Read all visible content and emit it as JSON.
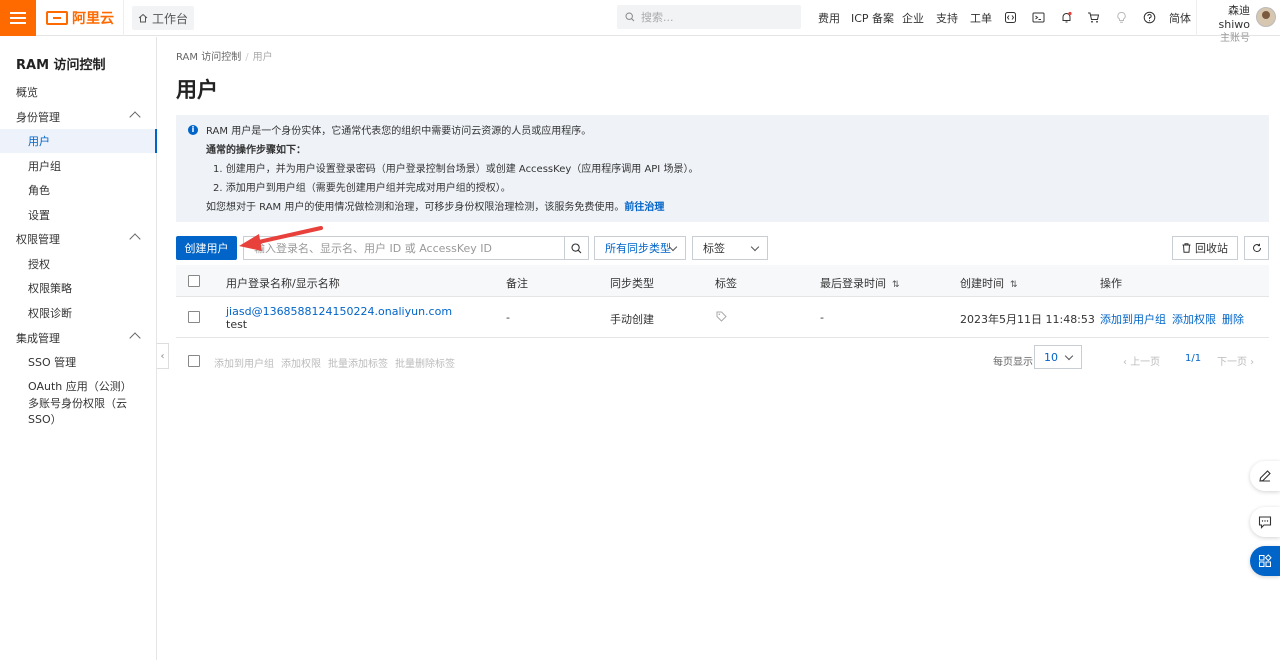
{
  "topbar": {
    "logo_text": "阿里云",
    "workbench": "工作台",
    "search_placeholder": "搜索...",
    "nav": [
      "费用",
      "ICP 备案",
      "企业",
      "支持",
      "工单"
    ],
    "lang": "简体",
    "user_name": "森迪shiwo",
    "user_role": "主账号"
  },
  "sidebar": {
    "title": "RAM 访问控制",
    "items": [
      {
        "label": "概览"
      },
      {
        "label": "身份管理"
      },
      {
        "label": "用户"
      },
      {
        "label": "用户组"
      },
      {
        "label": "角色"
      },
      {
        "label": "设置"
      },
      {
        "label": "权限管理"
      },
      {
        "label": "授权"
      },
      {
        "label": "权限策略"
      },
      {
        "label": "权限诊断"
      },
      {
        "label": "集成管理"
      },
      {
        "label": "SSO 管理"
      },
      {
        "label": "OAuth 应用（公测）"
      },
      {
        "label": "多账号身份权限（云 SSO）"
      }
    ]
  },
  "breadcrumb": {
    "root": "RAM 访问控制",
    "sep": "/",
    "current": "用户"
  },
  "page_title": "用户",
  "info": {
    "line1": "RAM 用户是一个身份实体，它通常代表您的组织中需要访问云资源的人员或应用程序。",
    "heading": "通常的操作步骤如下：",
    "step1": "1. 创建用户，并为用户设置登录密码（用户登录控制台场景）或创建 AccessKey（应用程序调用 API 场景）。",
    "step2": "2. 添加用户到用户组（需要先创建用户组并完成对用户组的授权）。",
    "line_last": "如您想对于 RAM 用户的使用情况做检测和治理，可移步身份权限治理检测，该服务免费使用。",
    "link": "前往治理"
  },
  "toolbar": {
    "create_user": "创建用户",
    "search_placeholder": "输入登录名、显示名、用户 ID 或 AccessKey ID",
    "sync_type": "所有同步类型",
    "tag": "标签",
    "recycle": "回收站"
  },
  "table": {
    "headers": {
      "name": "用户登录名称/显示名称",
      "note": "备注",
      "sync": "同步类型",
      "tag": "标签",
      "last_login": "最后登录时间",
      "created": "创建时间",
      "ops": "操作"
    },
    "rows": [
      {
        "login": "jiasd@1368588124150224.onaliyun.com",
        "display": "test",
        "note": "-",
        "sync": "手动创建",
        "last_login": "-",
        "created": "2023年5月11日 11:48:53",
        "op1": "添加到用户组",
        "op2": "添加权限",
        "op3": "删除"
      }
    ]
  },
  "footer": {
    "bulk": [
      "添加到用户组",
      "添加权限",
      "批量添加标签",
      "批量删除标签"
    ],
    "per_page_label": "每页显示",
    "page_size": "10",
    "prev": "上一页",
    "page": "1/1",
    "next": "下一页"
  },
  "colors": {
    "brand": "#ff6a00",
    "primary": "#0064c8",
    "info_bg": "#eff3f8",
    "arrow": "#e8403a"
  }
}
